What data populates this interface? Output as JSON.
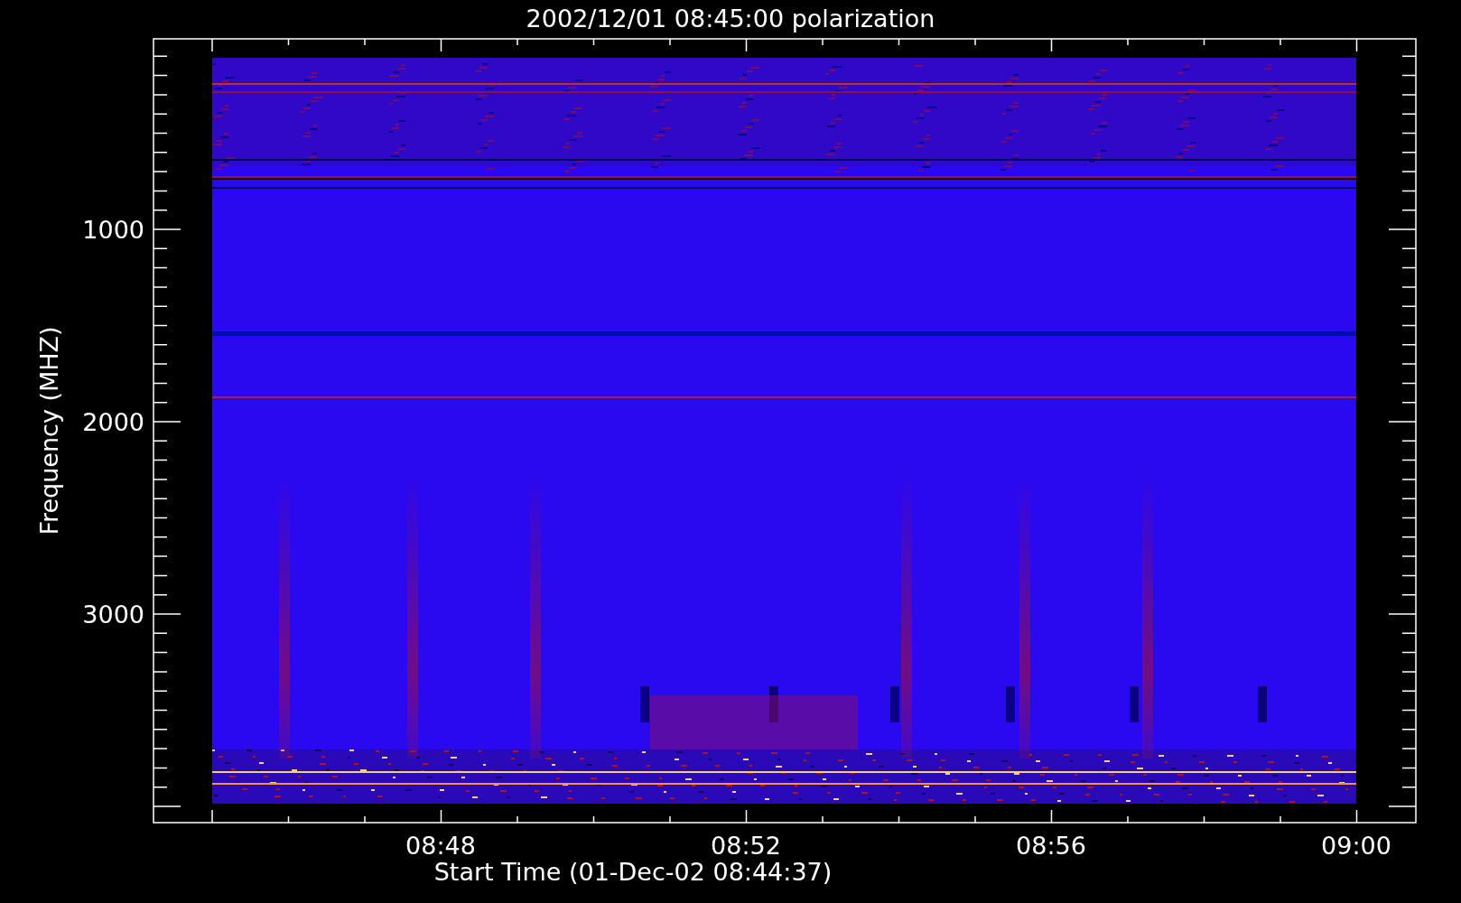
{
  "plot": {
    "title": "2002/12/01 08:45:00 polarization",
    "xlabel": "Start Time (01-Dec-02 08:44:37)",
    "ylabel": "Frequency (MHZ)",
    "xtick_labels": [
      "08:48",
      "08:52",
      "08:56",
      "09:00"
    ],
    "ytick_labels": [
      "1000",
      "2000",
      "3000"
    ]
  }
}
